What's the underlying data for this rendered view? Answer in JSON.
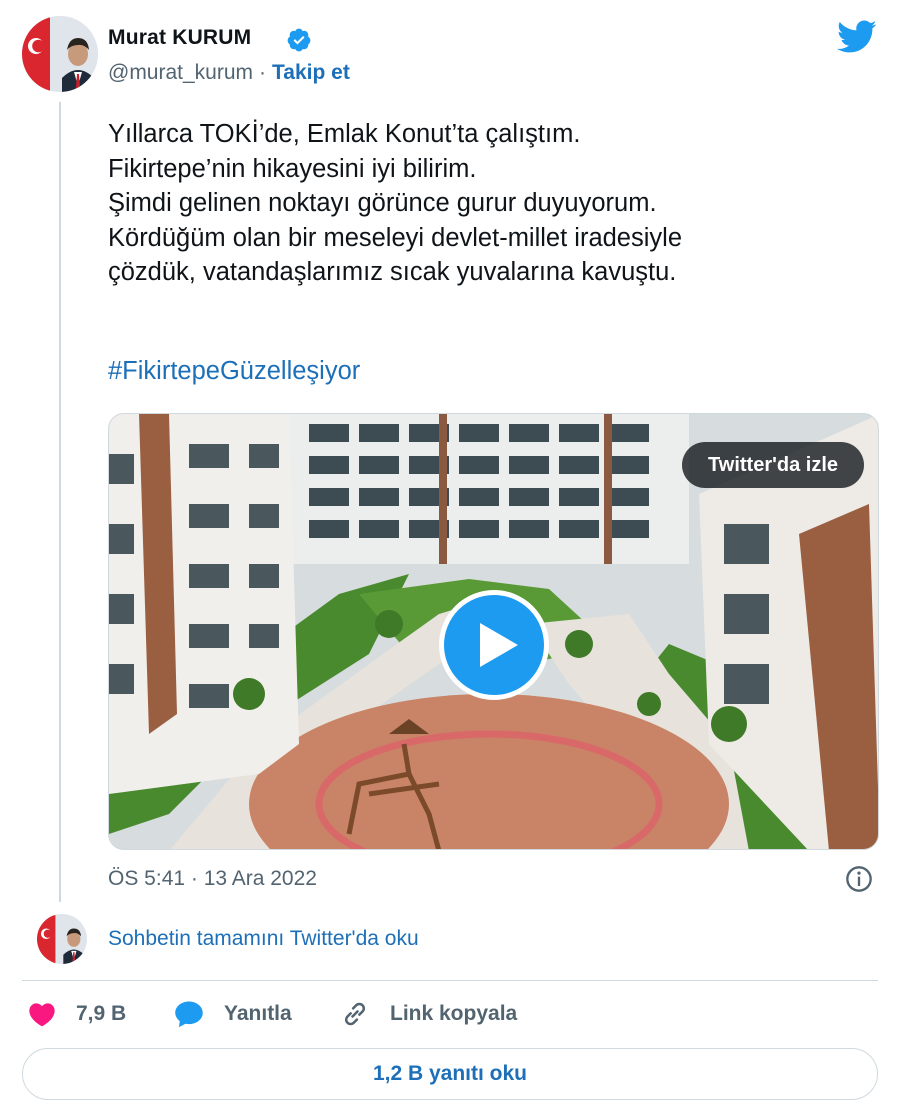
{
  "author": {
    "name": "Murat KURUM",
    "handle": "@murat_kurum",
    "separator": "·",
    "follow_label": "Takip et",
    "verified": true
  },
  "tweet": {
    "lines": [
      "Yıllarca TOKİ’de, Emlak Konut’ta çalıştım.",
      "Fikirtepe’nin hikayesini iyi bilirim.",
      "Şimdi gelinen noktayı görünce gurur duyuyorum.",
      "Kördüğüm olan bir meseleyi devlet-millet iradesiyle",
      "çözdük, vatandaşlarımız sıcak yuvalarına  kavuştu."
    ],
    "hashtag": "#FikirtepeGüzelleşiyor",
    "timestamp": "ÖS 5:41 · 13 Ara 2022"
  },
  "media": {
    "watch_label": "Twitter'da izle",
    "play_icon": "play-icon"
  },
  "conversation": {
    "link_label": "Sohbetin tamamını Twitter'da oku"
  },
  "actions": {
    "likes": "7,9 B",
    "reply_label": "Yanıtla",
    "copy_link_label": "Link kopyala"
  },
  "footer": {
    "read_replies_label": "1,2 B yanıtı oku"
  },
  "colors": {
    "link_blue": "#1d6fb8",
    "twitter_blue": "#1d9bf0",
    "like_pink": "#f91880",
    "text": "#0f1419",
    "secondary_text": "#536471",
    "border": "#cfd9de"
  },
  "icons": [
    "verified-icon",
    "twitter-logo-icon",
    "info-icon",
    "heart-icon",
    "reply-bubble-icon",
    "link-icon",
    "play-icon"
  ]
}
